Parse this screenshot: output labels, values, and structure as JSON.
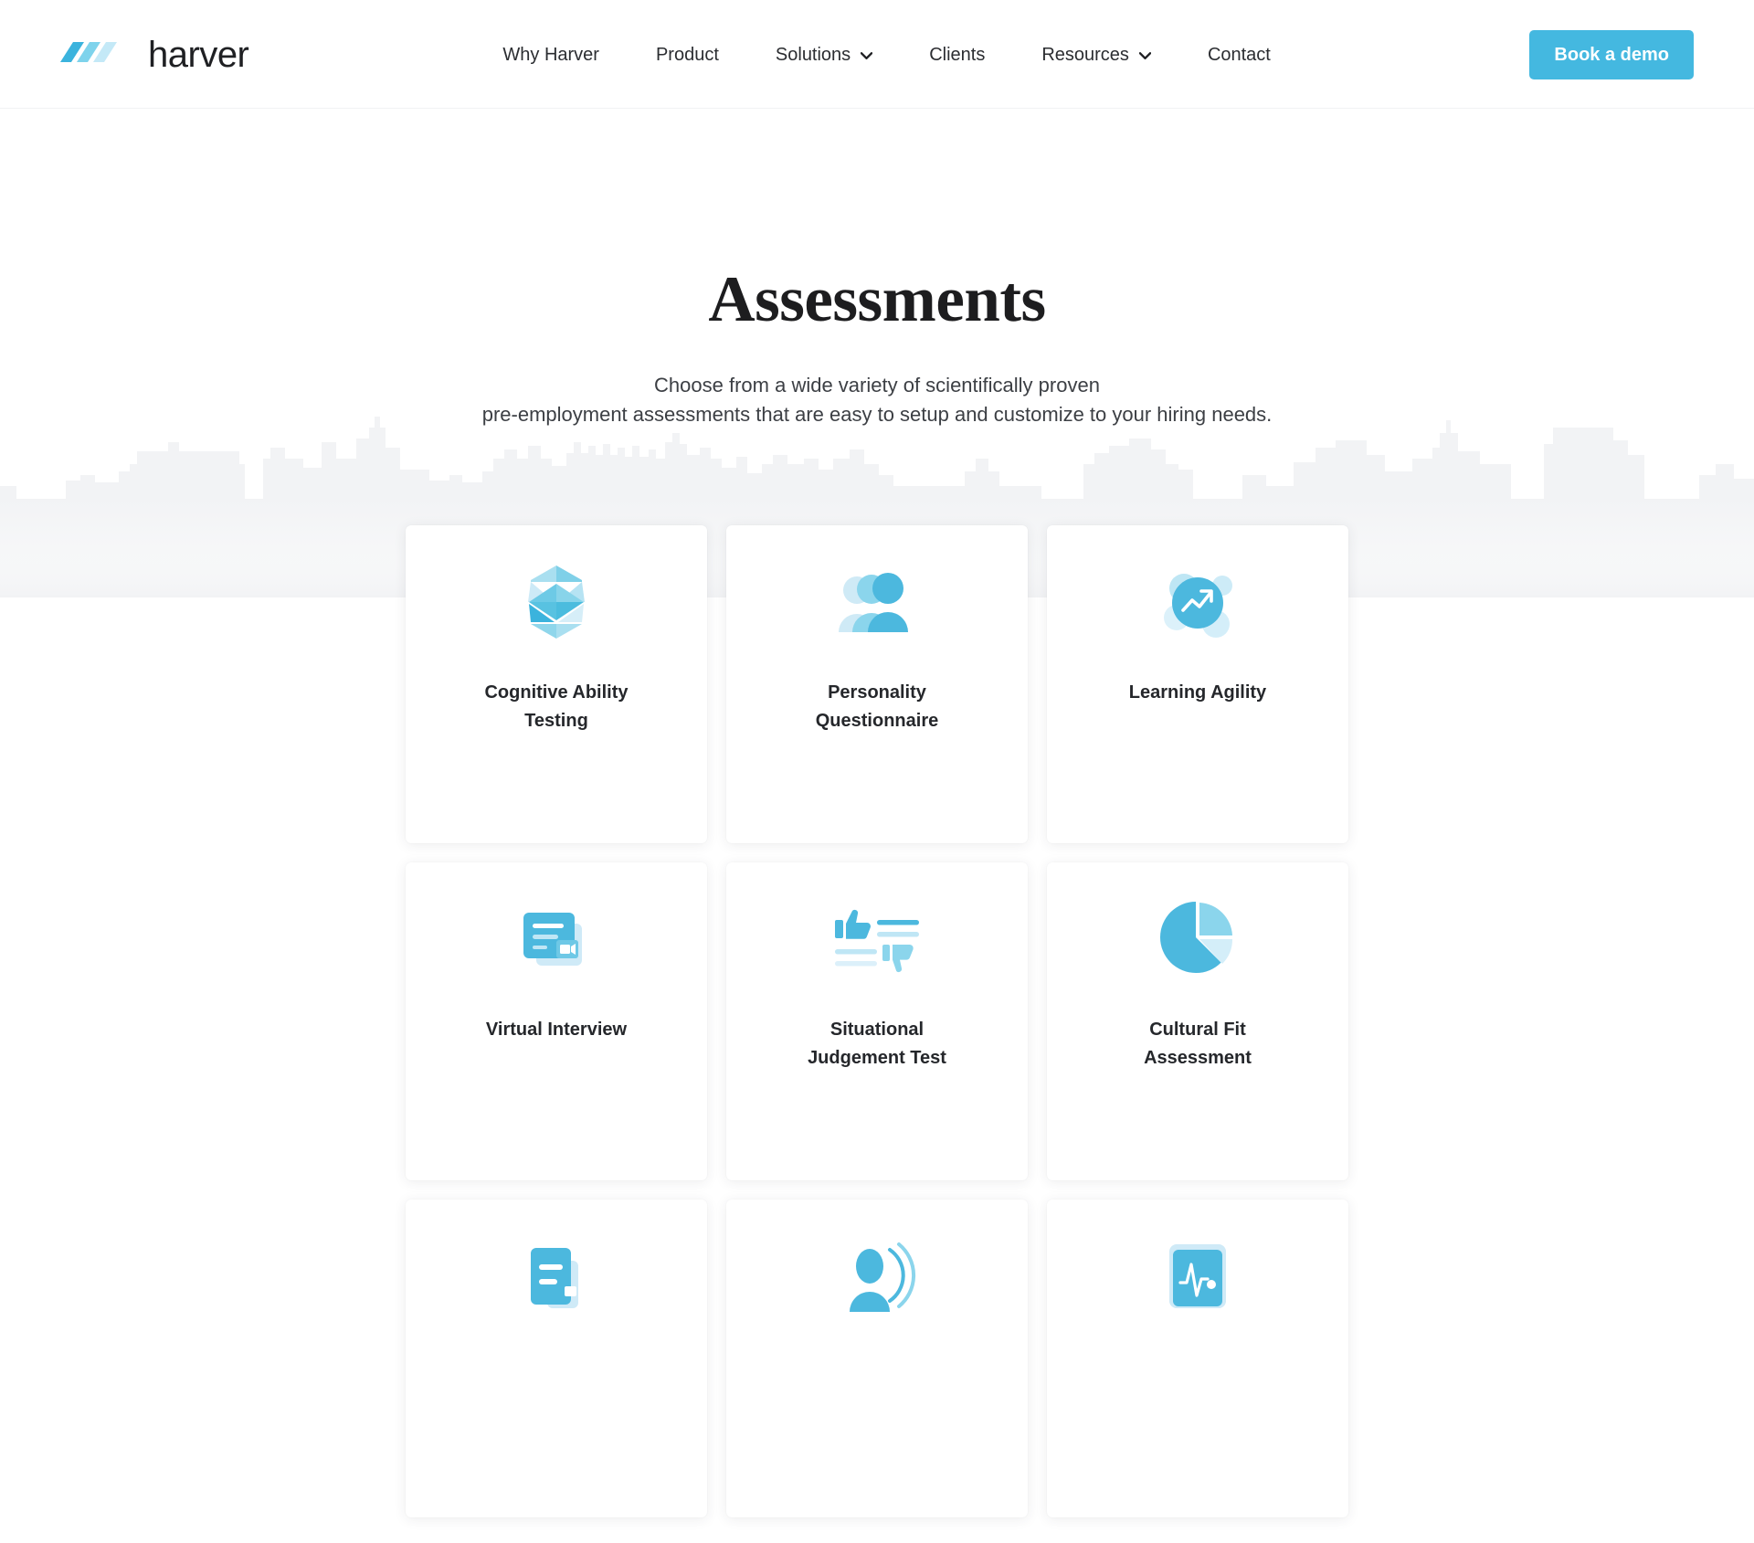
{
  "header": {
    "logo": {
      "text": "harver",
      "mark_name": "harver-logo-mark"
    },
    "nav": [
      {
        "label": "Why Harver",
        "has_dropdown": false
      },
      {
        "label": "Product",
        "has_dropdown": false
      },
      {
        "label": "Solutions",
        "has_dropdown": true
      },
      {
        "label": "Clients",
        "has_dropdown": false
      },
      {
        "label": "Resources",
        "has_dropdown": true
      },
      {
        "label": "Contact",
        "has_dropdown": false
      }
    ],
    "cta": {
      "label": "Book a demo"
    }
  },
  "hero": {
    "title": "Assessments",
    "subtitle_line1": "Choose from a wide variety of scientifically proven",
    "subtitle_line2": "pre-employment assessments that are easy to setup and customize to your hiring needs."
  },
  "cards": [
    {
      "label_line1": "Cognitive Ability",
      "label_line2": "Testing",
      "icon": "faceted-gem-icon"
    },
    {
      "label_line1": "Personality",
      "label_line2": "Questionnaire",
      "icon": "people-group-icon"
    },
    {
      "label_line1": "Learning Agility",
      "label_line2": "",
      "icon": "trending-up-circle-icon"
    },
    {
      "label_line1": "Virtual Interview",
      "label_line2": "",
      "icon": "video-card-icon"
    },
    {
      "label_line1": "Situational",
      "label_line2": "Judgement Test",
      "icon": "thumbs-up-down-icon"
    },
    {
      "label_line1": "Cultural Fit",
      "label_line2": "Assessment",
      "icon": "pie-chart-icon"
    },
    {
      "label_line1": "",
      "label_line2": "",
      "icon": "document-card-icon"
    },
    {
      "label_line1": "",
      "label_line2": "",
      "icon": "voice-person-icon"
    },
    {
      "label_line1": "",
      "label_line2": "",
      "icon": "pulse-waveform-icon"
    }
  ],
  "colors": {
    "brand_blue": "#44b8e0",
    "icon_blue_dark": "#3fb0d8",
    "icon_blue_mid": "#7fd0e8",
    "icon_blue_light": "#bde6f4",
    "icon_blue_pale": "#daf1fa",
    "text_dark": "#25272b",
    "skyline_gray": "#f2f3f5"
  }
}
